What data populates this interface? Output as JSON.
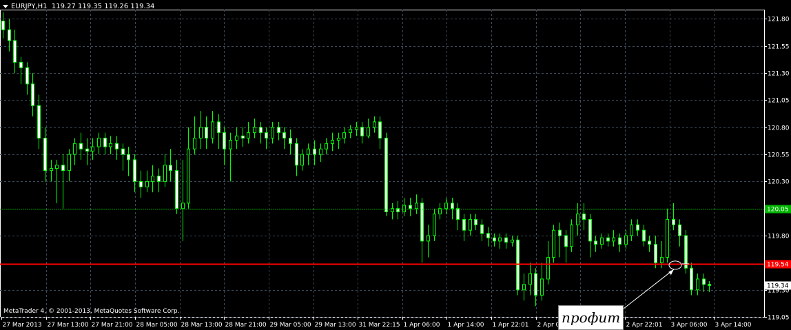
{
  "header": {
    "symbol": "EURJPY,H1",
    "ohlc": "119.27 119.35 119.26 119.34"
  },
  "copyright": "MetaTrader 4, © 2001-2013, MetaQuotes Software Corp.",
  "annotation": "профит",
  "colors": {
    "background": "#000000",
    "grid": "#3c4a5a",
    "candle_bull": "#000000",
    "candle_bear": "#ffffff",
    "wick": "#00ff00",
    "level_green": "#00b400",
    "level_red": "#ff0000"
  },
  "price_axis": {
    "min": 119.05,
    "max": 121.86,
    "ticks": [
      "121.80",
      "121.55",
      "121.30",
      "121.05",
      "120.80",
      "120.55",
      "120.30",
      "119.80",
      "119.30",
      "119.05"
    ],
    "tick_values": [
      121.8,
      121.55,
      121.3,
      121.05,
      120.8,
      120.55,
      120.3,
      119.8,
      119.3,
      119.05
    ]
  },
  "time_axis": {
    "labels": [
      "27 Mar 2013",
      "27 Mar 13:00",
      "27 Mar 21:00",
      "28 Mar 05:00",
      "28 Mar 13:00",
      "28 Mar 21:00",
      "29 Mar 05:00",
      "29 Mar 13:00",
      "31 Mar 22:15",
      "1 Apr 06:00",
      "1 Apr 14:00",
      "1 Apr 22:01",
      "2 Apr 06:00",
      "2 Apr 14:00",
      "2 Apr 22:01",
      "3 Apr 06:00",
      "3 Apr 14:00"
    ]
  },
  "levels": [
    {
      "name": "green-level",
      "price": 120.05,
      "label": "120.05",
      "color": "#00b400"
    },
    {
      "name": "red-level",
      "price": 119.54,
      "label": "119.54",
      "color": "#ff0000"
    },
    {
      "name": "current-price",
      "price": 119.34,
      "label": "119.34",
      "color": "#ffffff"
    }
  ],
  "chart_data": {
    "type": "candlestick",
    "title": "EURJPY,H1",
    "ylim": [
      119.05,
      121.86
    ],
    "candles": [
      [
        121.78,
        121.7,
        121.86,
        121.62
      ],
      [
        121.7,
        121.6,
        121.8,
        121.5
      ],
      [
        121.6,
        121.4,
        121.7,
        121.3
      ],
      [
        121.4,
        121.35,
        121.45,
        121.2
      ],
      [
        121.35,
        121.2,
        121.4,
        121.1
      ],
      [
        121.2,
        121.0,
        121.3,
        120.9
      ],
      [
        121.0,
        120.7,
        121.1,
        120.6
      ],
      [
        120.7,
        120.4,
        120.8,
        120.3
      ],
      [
        120.4,
        120.42,
        120.5,
        120.3
      ],
      [
        120.42,
        120.45,
        120.5,
        120.1
      ],
      [
        120.45,
        120.4,
        120.55,
        120.05
      ],
      [
        120.4,
        120.55,
        120.6,
        120.3
      ],
      [
        120.55,
        120.65,
        120.7,
        120.45
      ],
      [
        120.65,
        120.6,
        120.75,
        120.5
      ],
      [
        120.6,
        120.58,
        120.7,
        120.45
      ],
      [
        120.58,
        120.62,
        120.7,
        120.5
      ],
      [
        120.62,
        120.7,
        120.75,
        120.55
      ],
      [
        120.7,
        120.62,
        120.75,
        120.55
      ],
      [
        120.62,
        120.65,
        120.72,
        120.55
      ],
      [
        120.65,
        120.6,
        120.72,
        120.5
      ],
      [
        120.6,
        120.55,
        120.65,
        120.4
      ],
      [
        120.55,
        120.5,
        120.62,
        120.35
      ],
      [
        120.5,
        120.3,
        120.55,
        120.2
      ],
      [
        120.3,
        120.25,
        120.4,
        120.15
      ],
      [
        120.25,
        120.3,
        120.4,
        120.2
      ],
      [
        120.3,
        120.35,
        120.45,
        120.2
      ],
      [
        120.35,
        120.3,
        120.42,
        120.2
      ],
      [
        120.3,
        120.45,
        120.55,
        120.25
      ],
      [
        120.45,
        120.4,
        120.6,
        120.3
      ],
      [
        120.4,
        120.05,
        120.5,
        120.0
      ],
      [
        120.05,
        120.1,
        120.5,
        119.75
      ],
      [
        120.1,
        120.6,
        120.8,
        120.05
      ],
      [
        120.6,
        120.7,
        120.9,
        120.55
      ],
      [
        120.7,
        120.8,
        120.95,
        120.6
      ],
      [
        120.8,
        120.7,
        120.9,
        120.6
      ],
      [
        120.7,
        120.85,
        120.95,
        120.65
      ],
      [
        120.85,
        120.75,
        120.92,
        120.6
      ],
      [
        120.75,
        120.6,
        120.8,
        120.45
      ],
      [
        120.6,
        120.68,
        120.75,
        120.3
      ],
      [
        120.68,
        120.72,
        120.8,
        120.6
      ],
      [
        120.72,
        120.7,
        120.8,
        120.62
      ],
      [
        120.7,
        120.75,
        120.85,
        120.65
      ],
      [
        120.75,
        120.8,
        120.88,
        120.7
      ],
      [
        120.8,
        120.75,
        120.85,
        120.65
      ],
      [
        120.75,
        120.7,
        120.8,
        120.6
      ],
      [
        120.7,
        120.8,
        120.85,
        120.65
      ],
      [
        120.8,
        120.75,
        120.85,
        120.68
      ],
      [
        120.75,
        120.7,
        120.8,
        120.6
      ],
      [
        120.7,
        120.65,
        120.78,
        120.55
      ],
      [
        120.65,
        120.45,
        120.7,
        120.35
      ],
      [
        120.45,
        120.55,
        120.6,
        120.4
      ],
      [
        120.55,
        120.6,
        120.65,
        120.45
      ],
      [
        120.6,
        120.55,
        120.68,
        120.45
      ],
      [
        120.55,
        120.6,
        120.65,
        120.48
      ],
      [
        120.6,
        120.65,
        120.7,
        120.55
      ],
      [
        120.65,
        120.68,
        120.75,
        120.58
      ],
      [
        120.68,
        120.7,
        120.75,
        120.6
      ],
      [
        120.7,
        120.75,
        120.8,
        120.65
      ],
      [
        120.75,
        120.78,
        120.82,
        120.7
      ],
      [
        120.78,
        120.8,
        120.85,
        120.72
      ],
      [
        120.8,
        120.72,
        120.85,
        120.65
      ],
      [
        120.72,
        120.8,
        120.88,
        120.7
      ],
      [
        120.8,
        120.85,
        120.9,
        120.75
      ],
      [
        120.85,
        120.7,
        120.9,
        120.6
      ],
      [
        120.7,
        120.02,
        120.75,
        119.98
      ],
      [
        120.02,
        120.05,
        120.1,
        119.95
      ],
      [
        120.05,
        120.02,
        120.12,
        119.95
      ],
      [
        120.02,
        120.08,
        120.15,
        119.98
      ],
      [
        120.08,
        120.05,
        120.15,
        119.98
      ],
      [
        120.05,
        120.1,
        120.18,
        120.0
      ],
      [
        120.1,
        119.75,
        120.15,
        119.55
      ],
      [
        119.75,
        119.8,
        119.9,
        119.6
      ],
      [
        119.8,
        120.0,
        120.05,
        119.75
      ],
      [
        120.0,
        120.05,
        120.1,
        119.95
      ],
      [
        120.05,
        120.1,
        120.15,
        120.0
      ],
      [
        120.1,
        120.05,
        120.15,
        119.95
      ],
      [
        120.05,
        119.95,
        120.1,
        119.85
      ],
      [
        119.95,
        119.85,
        120.0,
        119.75
      ],
      [
        119.85,
        119.95,
        120.0,
        119.8
      ],
      [
        119.95,
        119.9,
        120.0,
        119.85
      ],
      [
        119.9,
        119.82,
        119.95,
        119.75
      ],
      [
        119.82,
        119.78,
        119.88,
        119.7
      ],
      [
        119.78,
        119.75,
        119.82,
        119.7
      ],
      [
        119.75,
        119.78,
        119.82,
        119.68
      ],
      [
        119.78,
        119.74,
        119.82,
        119.68
      ],
      [
        119.74,
        119.76,
        119.8,
        119.7
      ],
      [
        119.76,
        119.3,
        119.8,
        119.25
      ],
      [
        119.3,
        119.35,
        119.45,
        119.2
      ],
      [
        119.35,
        119.45,
        119.55,
        119.25
      ],
      [
        119.45,
        119.25,
        119.5,
        119.15
      ],
      [
        119.25,
        119.4,
        119.55,
        119.2
      ],
      [
        119.4,
        119.6,
        119.75,
        119.35
      ],
      [
        119.6,
        119.85,
        119.9,
        119.55
      ],
      [
        119.85,
        119.8,
        119.92,
        119.6
      ],
      [
        119.8,
        119.7,
        119.85,
        119.55
      ],
      [
        119.7,
        119.9,
        119.95,
        119.65
      ],
      [
        119.9,
        120.0,
        120.1,
        119.8
      ],
      [
        120.0,
        119.95,
        120.1,
        119.85
      ],
      [
        119.95,
        119.75,
        120.0,
        119.6
      ],
      [
        119.75,
        119.72,
        119.8,
        119.65
      ],
      [
        119.72,
        119.78,
        119.82,
        119.68
      ],
      [
        119.78,
        119.75,
        119.82,
        119.7
      ],
      [
        119.75,
        119.78,
        119.85,
        119.7
      ],
      [
        119.78,
        119.72,
        119.82,
        119.65
      ],
      [
        119.72,
        119.8,
        119.85,
        119.68
      ],
      [
        119.8,
        119.9,
        119.95,
        119.75
      ],
      [
        119.9,
        119.85,
        119.95,
        119.8
      ],
      [
        119.85,
        119.75,
        119.9,
        119.7
      ],
      [
        119.75,
        119.72,
        119.8,
        119.65
      ],
      [
        119.72,
        119.55,
        119.8,
        119.5
      ],
      [
        119.55,
        119.6,
        119.75,
        119.5
      ],
      [
        119.6,
        119.95,
        120.05,
        119.55
      ],
      [
        119.95,
        119.9,
        120.1,
        119.85
      ],
      [
        119.9,
        119.8,
        119.95,
        119.7
      ],
      [
        119.8,
        119.5,
        119.85,
        119.45
      ],
      [
        119.5,
        119.3,
        119.55,
        119.25
      ],
      [
        119.3,
        119.4,
        119.45,
        119.25
      ],
      [
        119.4,
        119.35,
        119.45,
        119.28
      ],
      [
        119.35,
        119.34,
        119.38,
        119.28
      ]
    ]
  }
}
